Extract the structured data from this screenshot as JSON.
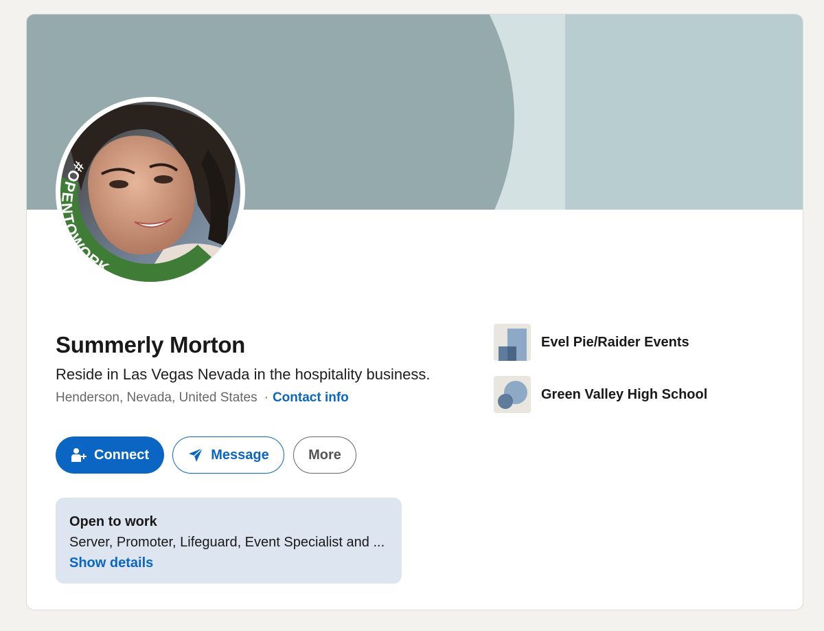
{
  "profile": {
    "name": "Summerly Morton",
    "headline": "Reside in Las Vegas Nevada in the hospitality business.",
    "location": "Henderson, Nevada, United States",
    "separator": "·",
    "contact_label": "Contact info",
    "badge_text": "#OPENTOWORK"
  },
  "actions": {
    "connect_label": "Connect",
    "message_label": "Message",
    "more_label": "More"
  },
  "open_to_work": {
    "title": "Open to work",
    "roles": "Server, Promoter, Lifeguard, Event Specialist and ...",
    "details_label": "Show details"
  },
  "organizations": [
    {
      "name": "Evel Pie/Raider Events",
      "icon": "company-logo-icon"
    },
    {
      "name": "Green Valley High School",
      "icon": "school-logo-icon"
    }
  ],
  "colors": {
    "accent": "#0a66c2",
    "page_background": "#f3f2ef",
    "banner_dark": "#94aaad",
    "banner_light": "#b8cdd0",
    "open_to_work_green": "#3a7a34",
    "open_to_work_box": "#dce5f0"
  }
}
